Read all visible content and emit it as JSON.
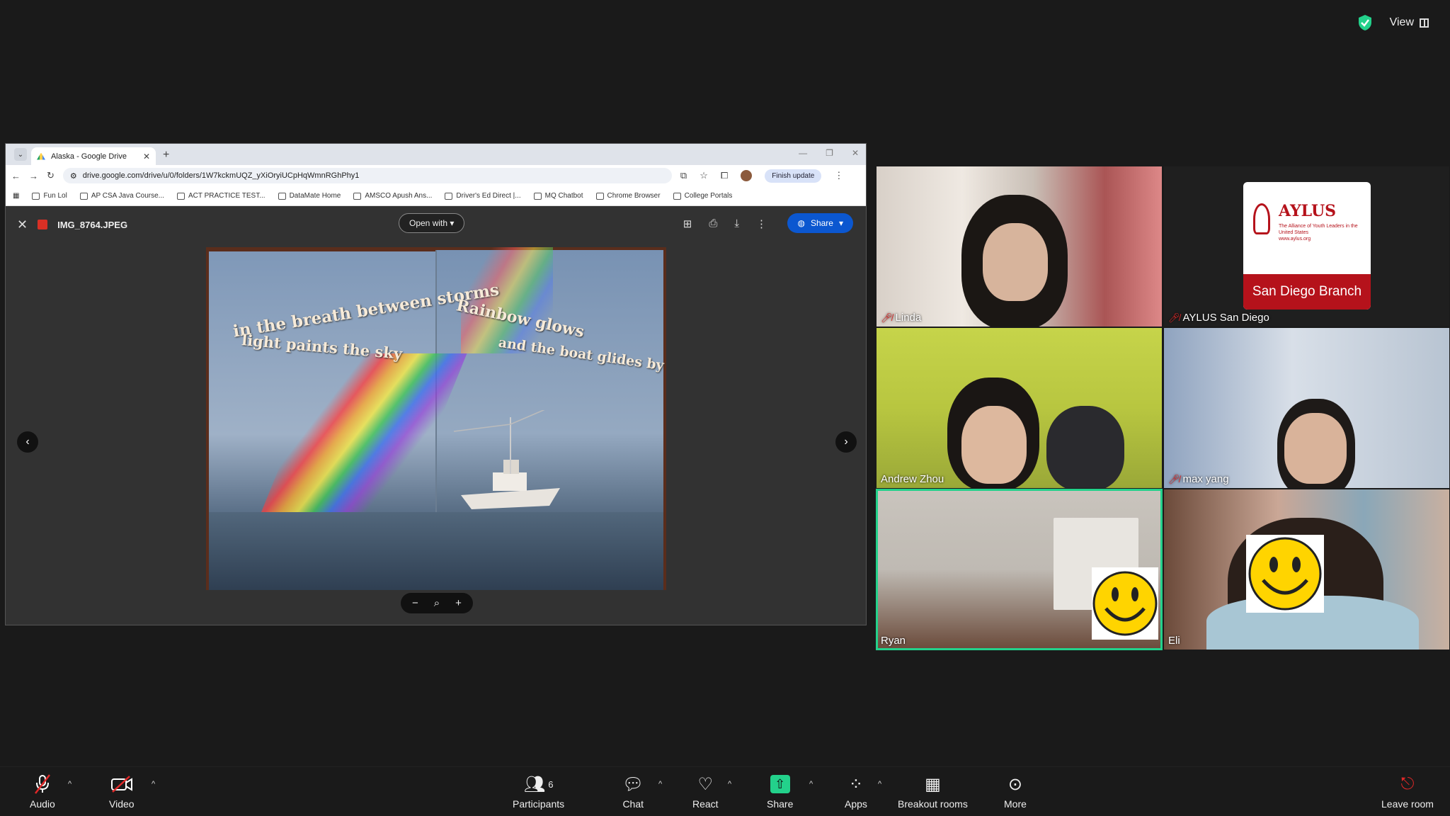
{
  "topbar": {
    "view_label": "View"
  },
  "browser": {
    "tab_title": "Alaska - Google Drive",
    "url": "drive.google.com/drive/u/0/folders/1W7kckmUQZ_yXiOryiUCpHqWmnRGhPhy1",
    "finish_update": "Finish update",
    "bookmarks": [
      "Fun Lol",
      "AP CSA Java Course...",
      "ACT PRACTICE TEST...",
      "DataMate Home",
      "AMSCO Apush Ans...",
      "Driver's Ed Direct |...",
      "MQ Chatbot",
      "Chrome Browser",
      "College Portals"
    ]
  },
  "viewer": {
    "file_name": "IMG_8764.JPEG",
    "open_with": "Open with",
    "share_label": "Share",
    "book_text": {
      "left_line1": "in the breath between storms",
      "left_line2": "light paints the sky",
      "right_line1": "Rainbow glows",
      "right_line2": "and the boat glides by"
    }
  },
  "participants": [
    {
      "name": "Linda",
      "muted": true
    },
    {
      "name": "AYLUS San Diego",
      "muted": true
    },
    {
      "name": "Andrew Zhou",
      "muted": false
    },
    {
      "name": "max yang",
      "muted": true
    },
    {
      "name": "Ryan",
      "muted": false
    },
    {
      "name": "Eli",
      "muted": false
    }
  ],
  "aylus_logo": {
    "word": "AYLUS",
    "tagline": "The Alliance of Youth Leaders in the United States",
    "site": "www.aylus.org",
    "branch": "San Diego Branch"
  },
  "toolbar": {
    "audio": "Audio",
    "video": "Video",
    "participants": "Participants",
    "participant_count": "6",
    "chat": "Chat",
    "react": "React",
    "share": "Share",
    "apps": "Apps",
    "breakout": "Breakout rooms",
    "more": "More",
    "leave": "Leave room"
  },
  "colors": {
    "active_speaker": "#23d18b",
    "share_green": "#23d18b",
    "mute_red": "#e02828",
    "drive_blue": "#0b57d0"
  }
}
